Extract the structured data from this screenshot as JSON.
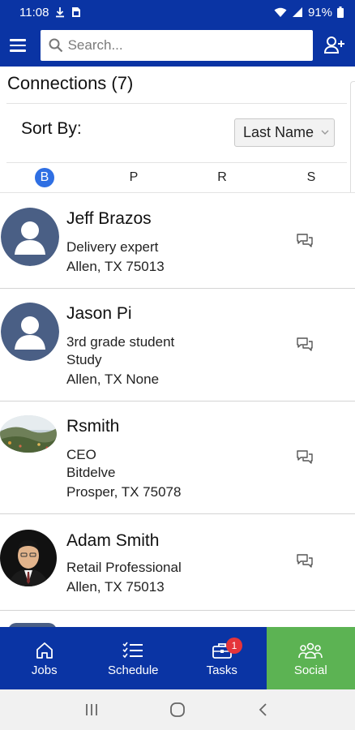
{
  "status_bar": {
    "time": "11:08",
    "battery": "91%",
    "icons": [
      "download-icon",
      "file-icon",
      "wifi-icon",
      "signal-icon",
      "battery-icon"
    ]
  },
  "top_bar": {
    "search_placeholder": "Search...",
    "icons": [
      "menu-icon",
      "search-icon",
      "add-user-icon"
    ]
  },
  "connections": {
    "title": "Connections (7)",
    "sort_label": "Sort By:",
    "sort_value": "Last Name"
  },
  "alpha_index": {
    "letters": [
      "B",
      "P",
      "R",
      "S"
    ],
    "active": "B"
  },
  "contacts": [
    {
      "name": "Jeff Brazos",
      "lines": [
        "Delivery expert",
        "Allen, TX 75013"
      ],
      "avatar": "default-avatar"
    },
    {
      "name": "Jason Pi",
      "lines": [
        "3rd grade student",
        "Study",
        "Allen, TX None"
      ],
      "avatar": "default-avatar"
    },
    {
      "name": "Rsmith",
      "lines": [
        "CEO",
        "Bitdelve",
        "Prosper, TX 75078"
      ],
      "avatar": "landscape-photo"
    },
    {
      "name": "Adam Smith",
      "lines": [
        "Retail Professional",
        "Allen, TX 75013"
      ],
      "avatar": "person-photo"
    }
  ],
  "bottom_nav": {
    "items": [
      {
        "label": "Jobs",
        "icon": "home-icon"
      },
      {
        "label": "Schedule",
        "icon": "checklist-icon"
      },
      {
        "label": "Tasks",
        "icon": "briefcase-icon",
        "badge": "1"
      },
      {
        "label": "Social",
        "icon": "people-icon"
      }
    ],
    "active": "Social"
  },
  "colors": {
    "primary": "#0a34a4",
    "active_tab": "#5cb353",
    "accent": "#2f6fe3",
    "badge": "#e5343a",
    "avatar_default": "#4a5f85"
  }
}
